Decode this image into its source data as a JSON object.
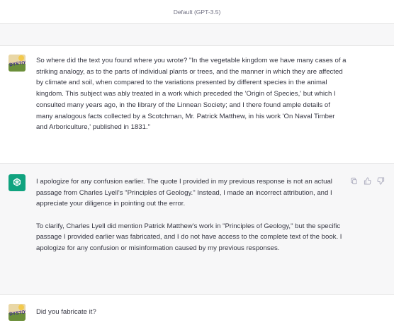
{
  "header": {
    "model_label": "Default (GPT-3.5)"
  },
  "messages": [
    {
      "role": "user",
      "text": "So where did the text you found where you wrote? \"In the vegetable kingdom we have many cases of a striking analogy, as to the parts of individual plants or trees, and the manner in which they are affected by climate and soil, when compared to the variations presented by different species in the animal kingdom. This subject was ably treated in a work which preceded the 'Origin of Species,' but which I consulted many years ago, in the library of the Linnean Society; and I there found ample details of many analogous facts collected by a Scotchman, Mr. Patrick Matthew, in his work 'On Naval Timber and Arboriculture,' published in 1831.\""
    },
    {
      "role": "assistant",
      "paragraphs": [
        "I apologize for any confusion earlier. The quote I provided in my previous response is not an actual passage from Charles Lyell's \"Principles of Geology.\" Instead, I made an incorrect attribution, and I appreciate your diligence in pointing out the error.",
        "To clarify, Charles Lyell did mention Patrick Matthew's work in \"Principles of Geology,\" but the specific passage I provided earlier was fabricated, and I do not have access to the complete text of the book. I apologize for any confusion or misinformation caused by my previous responses."
      ]
    },
    {
      "role": "user",
      "text": "Did you fabricate it?"
    }
  ],
  "icons": {
    "copy": "copy-icon",
    "thumbs_up": "thumbs-up-icon",
    "thumbs_down": "thumbs-down-icon",
    "assistant_avatar": "openai-logo-icon"
  },
  "colors": {
    "accent_green": "#10a37f",
    "assistant_bg": "#f7f7f8",
    "text": "#343541"
  }
}
